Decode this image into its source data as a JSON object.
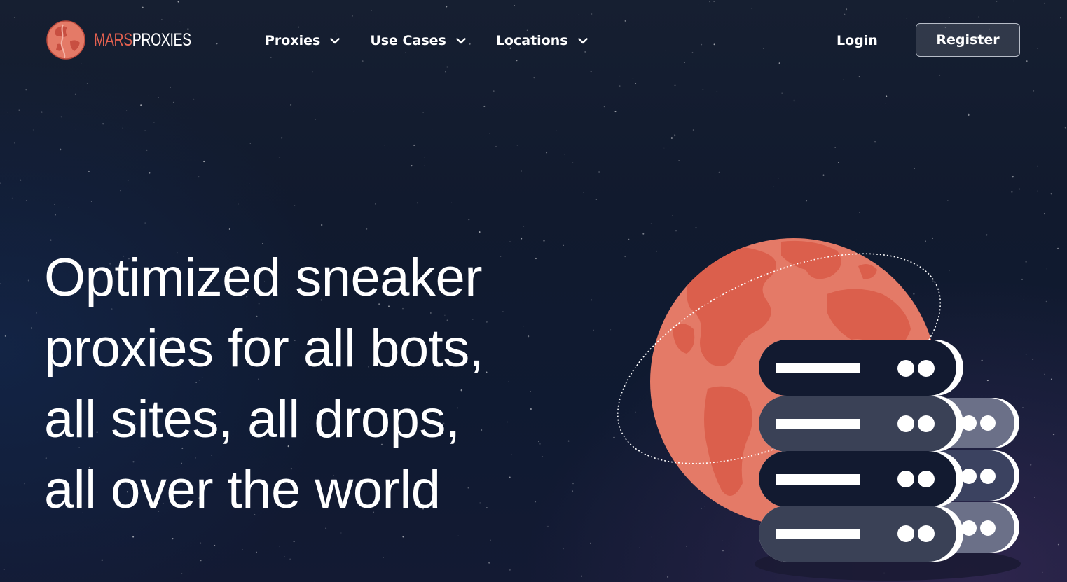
{
  "brand": {
    "name_part1": "MARS",
    "name_part2": "PROXIES",
    "accent_color": "#e2604f"
  },
  "nav": {
    "items": [
      {
        "label": "Proxies",
        "icon": "chevron-down-icon"
      },
      {
        "label": "Use Cases",
        "icon": "chevron-down-icon"
      },
      {
        "label": "Locations",
        "icon": "chevron-down-icon"
      }
    ]
  },
  "auth": {
    "login_label": "Login",
    "register_label": "Register"
  },
  "hero": {
    "title_lines": [
      "Optimized sneaker",
      "proxies for all bots,",
      "all sites, all drops,",
      "all over the world"
    ]
  },
  "illustration": {
    "globe_color": "#e47a67",
    "land_color": "#db5f4c",
    "server_dark": "#121a30",
    "server_slate": "#3a4156",
    "server_back": "#6b7088"
  }
}
